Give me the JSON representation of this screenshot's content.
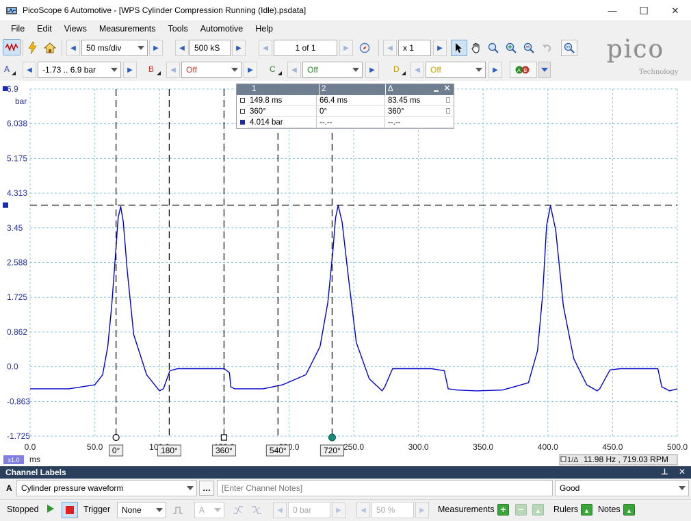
{
  "window": {
    "title": "PicoScope 6 Automotive - [WPS Cylinder Compression Running (Idle).psdata]",
    "minimize": "—",
    "maximize": "☐",
    "close": "✕"
  },
  "menu": [
    "File",
    "Edit",
    "Views",
    "Measurements",
    "Tools",
    "Automotive",
    "Help"
  ],
  "toolbar1": {
    "timebase": "50 ms/div",
    "samples": "500 kS",
    "buffer": "1 of 1",
    "zoom": "x 1"
  },
  "toolbar2": {
    "channel_a": {
      "letter": "A",
      "range": "-1.73 .. 6.9 bar"
    },
    "channel_b": {
      "letter": "B",
      "range": "Off"
    },
    "channel_c": {
      "letter": "C",
      "range": "Off"
    },
    "channel_d": {
      "letter": "D",
      "range": "Off"
    }
  },
  "logo": {
    "brand": "pico",
    "sub": "Technology"
  },
  "chart_data": {
    "type": "line",
    "title": "",
    "xlabel": "ms",
    "ylabel": "bar",
    "xlim": [
      0,
      500
    ],
    "ylim": [
      -1.725,
      6.9
    ],
    "x_ticks": [
      "0.0",
      "50.0",
      "100.0",
      "150.0",
      "200.0",
      "250.0",
      "300.0",
      "350.0",
      "400.0",
      "450.0",
      "500.0"
    ],
    "y_ticks": [
      "6.9",
      "6.038",
      "5.175",
      "4.313",
      "3.45",
      "2.588",
      "1.725",
      "0.862",
      "0.0",
      "-0.863",
      "-1.725"
    ],
    "x_tick_values": [
      0,
      50,
      100,
      150,
      200,
      250,
      300,
      350,
      400,
      450,
      500
    ],
    "y_tick_values": [
      6.9,
      6.038,
      5.175,
      4.313,
      3.45,
      2.588,
      1.725,
      0.862,
      0.0,
      -0.863,
      -1.725
    ],
    "series": [
      {
        "name": "Cylinder pressure waveform",
        "color": "#0000cc",
        "x": [
          0,
          30,
          50,
          56,
          60,
          63,
          66,
          68,
          70,
          72,
          75,
          80,
          90,
          100,
          103,
          108,
          114,
          125,
          140,
          150,
          154,
          155,
          158,
          168,
          180,
          195,
          213,
          224,
          230,
          234,
          236,
          238,
          241,
          246,
          252,
          262,
          272,
          274,
          280,
          290,
          310,
          320,
          323,
          330,
          345,
          365,
          385,
          392,
          396,
          399,
          402,
          406,
          412,
          420,
          430,
          438,
          440,
          448,
          456,
          470,
          480,
          485,
          488,
          494,
          500
        ],
        "y": [
          -0.55,
          -0.55,
          -0.45,
          -0.2,
          0.5,
          1.5,
          2.8,
          3.7,
          3.98,
          3.6,
          2.4,
          0.8,
          -0.2,
          -0.6,
          -0.55,
          -0.1,
          -0.05,
          -0.05,
          -0.05,
          -0.05,
          -0.15,
          -0.5,
          -0.55,
          -0.55,
          -0.55,
          -0.45,
          -0.2,
          0.5,
          1.6,
          2.9,
          3.7,
          4.01,
          3.6,
          2.2,
          0.6,
          -0.3,
          -0.6,
          -0.5,
          -0.05,
          -0.05,
          -0.05,
          -0.1,
          -0.55,
          -0.58,
          -0.6,
          -0.58,
          -0.4,
          0.4,
          1.8,
          3.5,
          4.0,
          3.4,
          1.5,
          0.2,
          -0.45,
          -0.6,
          -0.55,
          -0.08,
          -0.05,
          -0.05,
          -0.05,
          -0.05,
          -0.5,
          -0.6,
          -0.55
        ]
      }
    ],
    "cursors": {
      "vertical_ms": [
        66.4,
        107.5,
        149.8,
        191.5,
        233.3
      ],
      "vertical_labels": [
        "0°",
        "180°",
        "360°",
        "540°",
        "720°"
      ],
      "horizontal_bar": 4.014
    },
    "x_scale_badge": "x1.0",
    "frequency_readout": "11.98 Hz , 719.03 RPM",
    "frequency_badge": "1/Δ"
  },
  "measurement_table": {
    "headers": [
      "1",
      "2",
      "Δ"
    ],
    "rows": [
      [
        "149.8 ms",
        "66.4 ms",
        "83.45 ms"
      ],
      [
        "360°",
        "0°",
        "360°"
      ],
      [
        "4.014 bar",
        "--.--",
        "--.--"
      ]
    ]
  },
  "channel_labels": {
    "title": "Channel Labels",
    "channel": "A",
    "name": "Cylinder pressure waveform",
    "notes_placeholder": "[Enter Channel Notes]",
    "quality": "Good"
  },
  "status": {
    "state": "Stopped",
    "trigger_label": "Trigger",
    "trigger_mode": "None",
    "trigger_channel": "A",
    "threshold": "0 bar",
    "pretrigger": "50 %",
    "measurements": "Measurements",
    "rulers": "Rulers",
    "notes": "Notes"
  }
}
